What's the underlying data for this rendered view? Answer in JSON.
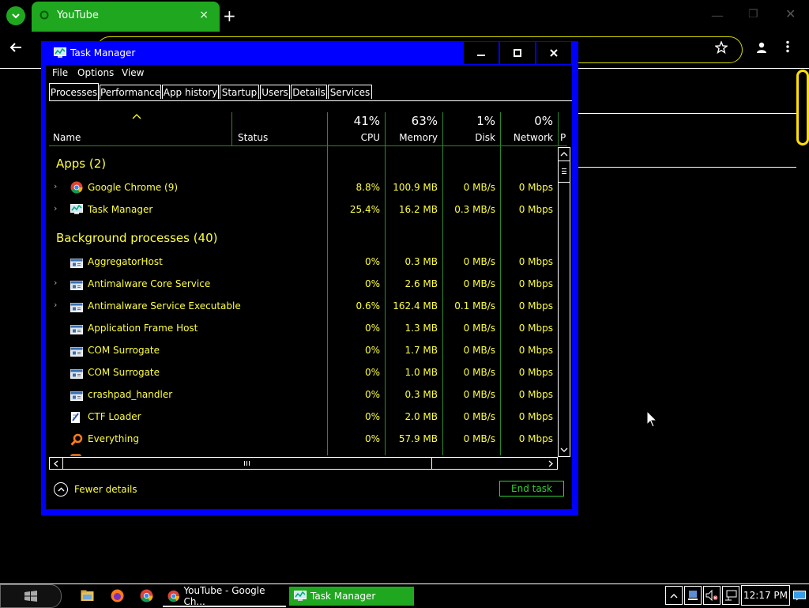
{
  "browser": {
    "tab_title": "YouTube",
    "new_tab": "+",
    "close_tab": "×"
  },
  "task_manager": {
    "title": "Task Manager",
    "menu": [
      "File",
      "Options",
      "View"
    ],
    "tabs": [
      "Processes",
      "Performance",
      "App history",
      "Startup",
      "Users",
      "Details",
      "Services"
    ],
    "active_tab": "Processes",
    "columns": {
      "name": "Name",
      "status": "Status",
      "cpu": {
        "pct": "41%",
        "label": "CPU"
      },
      "memory": {
        "pct": "63%",
        "label": "Memory"
      },
      "disk": {
        "pct": "1%",
        "label": "Disk"
      },
      "network": {
        "pct": "0%",
        "label": "Network"
      },
      "power": "P"
    },
    "groups": {
      "apps": "Apps (2)",
      "background": "Background processes (40)"
    },
    "apps": [
      {
        "name": "Google Chrome (9)",
        "cpu": "8.8%",
        "memory": "100.9 MB",
        "disk": "0 MB/s",
        "network": "0 Mbps",
        "icon": "chrome-icon",
        "expandable": true
      },
      {
        "name": "Task Manager",
        "cpu": "25.4%",
        "memory": "16.2 MB",
        "disk": "0.3 MB/s",
        "network": "0 Mbps",
        "icon": "taskmanager-icon",
        "expandable": true
      }
    ],
    "background": [
      {
        "name": "AggregatorHost",
        "cpu": "0%",
        "memory": "0.3 MB",
        "disk": "0 MB/s",
        "network": "0 Mbps",
        "icon": "process-icon",
        "expandable": false
      },
      {
        "name": "Antimalware Core Service",
        "cpu": "0%",
        "memory": "2.6 MB",
        "disk": "0 MB/s",
        "network": "0 Mbps",
        "icon": "process-icon",
        "expandable": true
      },
      {
        "name": "Antimalware Service Executable",
        "cpu": "0.6%",
        "memory": "162.4 MB",
        "disk": "0.1 MB/s",
        "network": "0 Mbps",
        "icon": "process-icon",
        "expandable": true
      },
      {
        "name": "Application Frame Host",
        "cpu": "0%",
        "memory": "1.3 MB",
        "disk": "0 MB/s",
        "network": "0 Mbps",
        "icon": "process-icon",
        "expandable": false
      },
      {
        "name": "COM Surrogate",
        "cpu": "0%",
        "memory": "1.7 MB",
        "disk": "0 MB/s",
        "network": "0 Mbps",
        "icon": "process-icon",
        "expandable": false
      },
      {
        "name": "COM Surrogate",
        "cpu": "0%",
        "memory": "1.0 MB",
        "disk": "0 MB/s",
        "network": "0 Mbps",
        "icon": "process-icon",
        "expandable": false
      },
      {
        "name": "crashpad_handler",
        "cpu": "0%",
        "memory": "0.3 MB",
        "disk": "0 MB/s",
        "network": "0 Mbps",
        "icon": "process-icon",
        "expandable": false
      },
      {
        "name": "CTF Loader",
        "cpu": "0%",
        "memory": "2.0 MB",
        "disk": "0 MB/s",
        "network": "0 Mbps",
        "icon": "ctf-icon",
        "expandable": false
      },
      {
        "name": "Everything",
        "cpu": "0%",
        "memory": "57.9 MB",
        "disk": "0 MB/s",
        "network": "0 Mbps",
        "icon": "search-icon",
        "expandable": false
      }
    ],
    "fewer_details": "Fewer details",
    "end_task": "End task"
  },
  "taskbar": {
    "chrome_window": "YouTube - Google Ch...",
    "task_manager": "Task Manager",
    "clock": "12:17 PM"
  },
  "colors": {
    "accent_green": "#1fa81f",
    "window_blue": "#0000ff",
    "text_yellow": "#ffff40",
    "grid_green": "#2a8a2a"
  }
}
